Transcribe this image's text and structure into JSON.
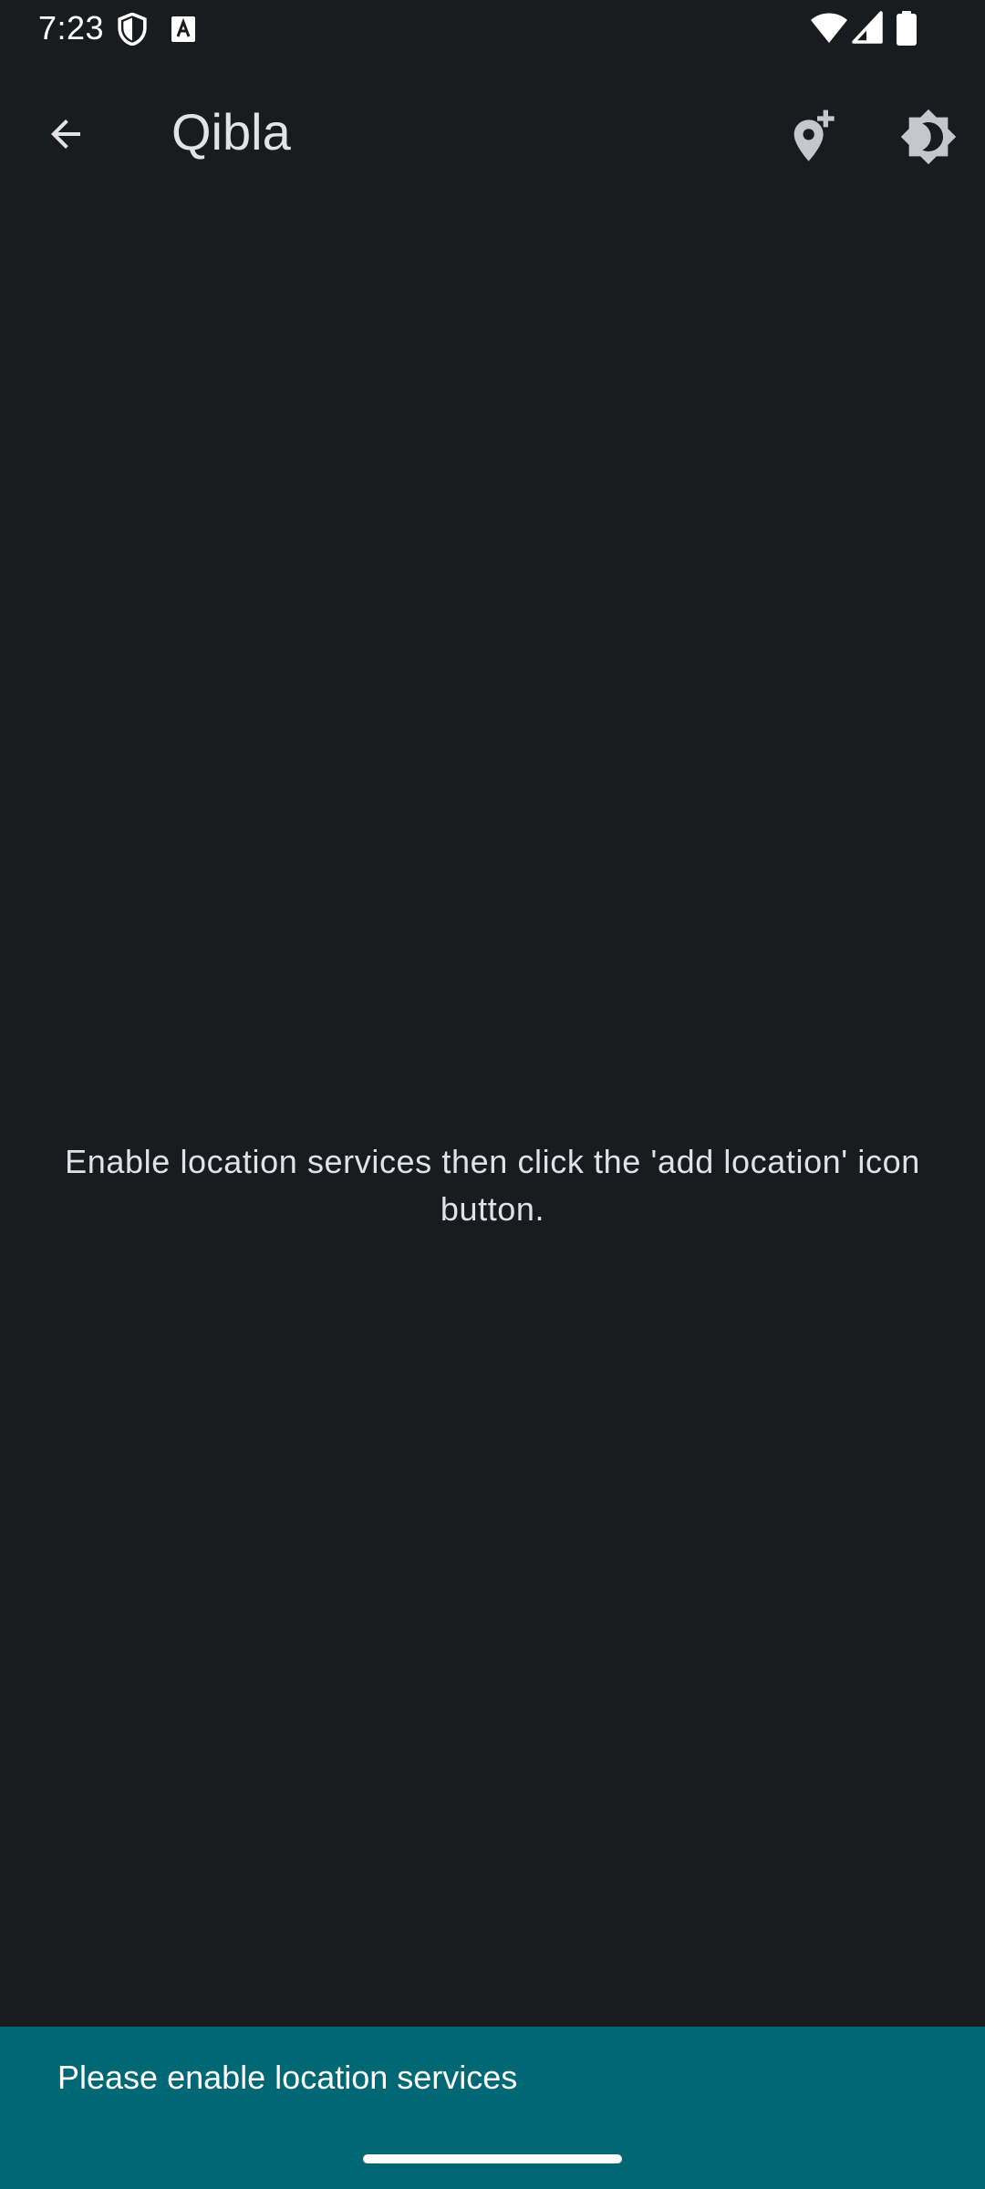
{
  "status_bar": {
    "time": "7:23",
    "icons_left": [
      "shield-icon",
      "text-a-icon"
    ],
    "icons_right": [
      "wifi-icon",
      "signal-icon",
      "battery-icon"
    ]
  },
  "app_bar": {
    "title": "Qibla",
    "back_icon": "arrow-back-icon",
    "actions": [
      "add-location-icon",
      "brightness-icon"
    ]
  },
  "main": {
    "message": "Enable location services then click the 'add location' icon button."
  },
  "snackbar": {
    "text": "Please enable location services"
  },
  "colors": {
    "background": "#191c1f",
    "snackbar": "#006875",
    "text": "#e1e3e6"
  }
}
